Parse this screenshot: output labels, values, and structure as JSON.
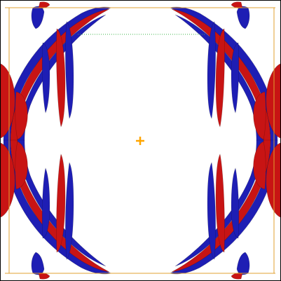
{
  "viewport": {
    "background": "#ffffff",
    "frame_color": "#000000"
  },
  "overlay": {
    "bounds_color": "#e0a030",
    "crosshair_color": "#ffa500",
    "guide_color": "#3cb44b"
  },
  "surface": {
    "positive_color": "#c81414",
    "negative_color": "#1e1eb4",
    "highlight_color": "#ffffff"
  },
  "icons": {
    "center": "crosshair-icon"
  }
}
